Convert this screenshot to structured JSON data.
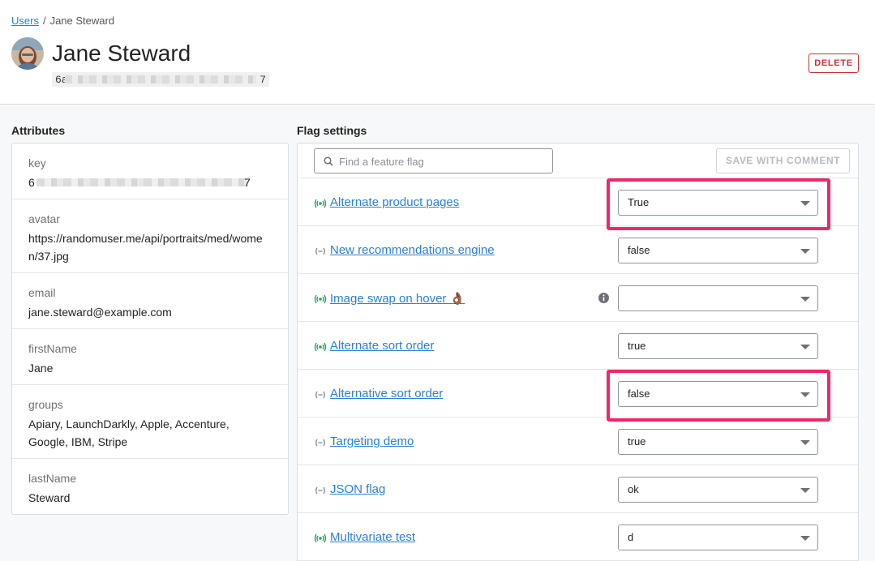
{
  "breadcrumb": {
    "root": "Users",
    "separator": "/",
    "current": "Jane Steward"
  },
  "user": {
    "name": "Jane Steward",
    "key_first": "6a",
    "key_last": "7"
  },
  "header": {
    "delete_label": "DELETE"
  },
  "attributes": {
    "title": "Attributes",
    "items": [
      {
        "key": "key",
        "value_first": "6",
        "value_last": "7",
        "redacted": true
      },
      {
        "key": "avatar",
        "value": "https://randomuser.me/api/portraits/med/women/37.jpg"
      },
      {
        "key": "email",
        "value": "jane.steward@example.com"
      },
      {
        "key": "firstName",
        "value": "Jane"
      },
      {
        "key": "groups",
        "value": "Apiary, LaunchDarkly, Apple, Accenture, Google, IBM, Stripe"
      },
      {
        "key": "lastName",
        "value": "Steward"
      }
    ]
  },
  "flags": {
    "title": "Flag settings",
    "search_placeholder": "Find a feature flag",
    "save_label": "SAVE WITH COMMENT",
    "highlight_color": "#f0266b",
    "items": [
      {
        "name": "Alternate product pages",
        "value": "True",
        "status": "on",
        "highlighted": true
      },
      {
        "name": "New recommendations engine",
        "value": "false",
        "status": "off"
      },
      {
        "name": "Image swap on hover 👌🏾",
        "value": "",
        "status": "on",
        "info": true
      },
      {
        "name": "Alternate sort order",
        "value": "true",
        "status": "on"
      },
      {
        "name": "Alternative sort order",
        "value": "false",
        "status": "off",
        "highlighted": true
      },
      {
        "name": "Targeting demo",
        "value": "true",
        "status": "off"
      },
      {
        "name": "JSON flag",
        "value": "ok",
        "status": "off"
      },
      {
        "name": "Multivariate test",
        "value": "d",
        "status": "on"
      }
    ]
  }
}
